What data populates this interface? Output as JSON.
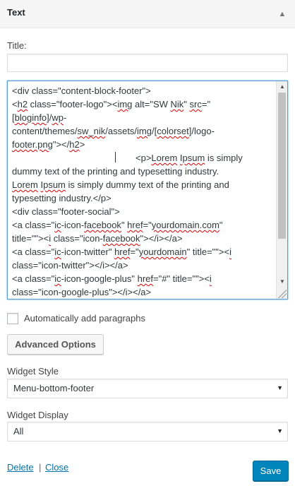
{
  "widget": {
    "title": "Text"
  },
  "title_field": {
    "label": "Title:",
    "value": ""
  },
  "content": {
    "lines": [
      [
        [
          "<div class=\"content-block-footer\">",
          false
        ]
      ],
      [
        [
          "<",
          false
        ],
        [
          "h2",
          true
        ],
        [
          " class=\"footer-logo\"><",
          false
        ],
        [
          "img",
          true
        ],
        [
          " alt=\"SW ",
          false
        ],
        [
          "Nik",
          true
        ],
        [
          "\" ",
          false
        ],
        [
          "src",
          true
        ],
        [
          "=\"",
          false
        ]
      ],
      [
        [
          "[",
          false
        ],
        [
          "bloginfo",
          true
        ],
        [
          "]/",
          false
        ],
        [
          "wp",
          true
        ],
        [
          "-",
          false
        ]
      ],
      [
        [
          "content/themes/",
          false
        ],
        [
          "sw_nik",
          true
        ],
        [
          "/assets/",
          false
        ],
        [
          "img",
          true
        ],
        [
          "/[",
          false
        ],
        [
          "colorset",
          true
        ],
        [
          "]/logo-",
          false
        ]
      ],
      [
        [
          "footer.png",
          true
        ],
        [
          "\"></",
          false
        ],
        [
          "h2",
          true
        ],
        [
          ">",
          false
        ]
      ],
      [
        [
          "CARET",
          false
        ],
        [
          "<p>",
          false
        ],
        [
          "Lorem",
          true
        ],
        [
          " ",
          false
        ],
        [
          "Ipsum",
          true
        ],
        [
          " is simply",
          false
        ]
      ],
      [
        [
          "dummy text of the printing and typesetting industry.",
          false
        ]
      ],
      [
        [
          "Lorem",
          true
        ],
        [
          " ",
          false
        ],
        [
          "Ipsum",
          true
        ],
        [
          " is simply dummy text of the printing and",
          false
        ]
      ],
      [
        [
          "typesetting industry.</p>",
          false
        ]
      ],
      [
        [
          "<div class=\"footer-social\">",
          false
        ]
      ],
      [
        [
          "<a class=\"",
          false
        ],
        [
          "ic",
          true
        ],
        [
          "-icon-",
          false
        ],
        [
          "facebook",
          true
        ],
        [
          "\" ",
          false
        ],
        [
          "href",
          true
        ],
        [
          "=\"",
          false
        ],
        [
          "yourdomain.com",
          true
        ],
        [
          "\"",
          false
        ]
      ],
      [
        [
          "title=\"\"><",
          false
        ],
        [
          "i",
          true
        ],
        [
          " class=\"icon-",
          false
        ],
        [
          "facebook",
          true
        ],
        [
          "\"></i></a>",
          false
        ]
      ],
      [
        [
          "<a class=\"",
          false
        ],
        [
          "ic",
          true
        ],
        [
          "-icon-twitter\" ",
          false
        ],
        [
          "href",
          true
        ],
        [
          "=\"",
          false
        ],
        [
          "yourdomain",
          true
        ],
        [
          "\" title=\"\"><",
          false
        ],
        [
          "i",
          true
        ]
      ],
      [
        [
          "class=\"icon-twitter\"></i></a>",
          false
        ]
      ],
      [
        [
          "<a class=\"",
          false
        ],
        [
          "ic",
          true
        ],
        [
          "-icon-google-plus\" ",
          false
        ],
        [
          "href",
          true
        ],
        [
          "=\"#\" title=\"\"><",
          false
        ],
        [
          "i",
          true
        ]
      ],
      [
        [
          "class=\"icon-google-plus\"></i></a>",
          false
        ]
      ]
    ]
  },
  "auto_paragraphs": {
    "label": "Automatically add paragraphs",
    "checked": false
  },
  "advanced_button": "Advanced Options",
  "widget_style": {
    "label": "Widget Style",
    "selected": "Menu-bottom-footer"
  },
  "widget_display": {
    "label": "Widget Display",
    "selected": "All"
  },
  "footer": {
    "delete": "Delete",
    "separator": "|",
    "close": "Close",
    "save": "Save"
  },
  "colors": {
    "accent": "#0085ba",
    "link": "#0073aa",
    "focus_border": "#5b9dd9"
  }
}
